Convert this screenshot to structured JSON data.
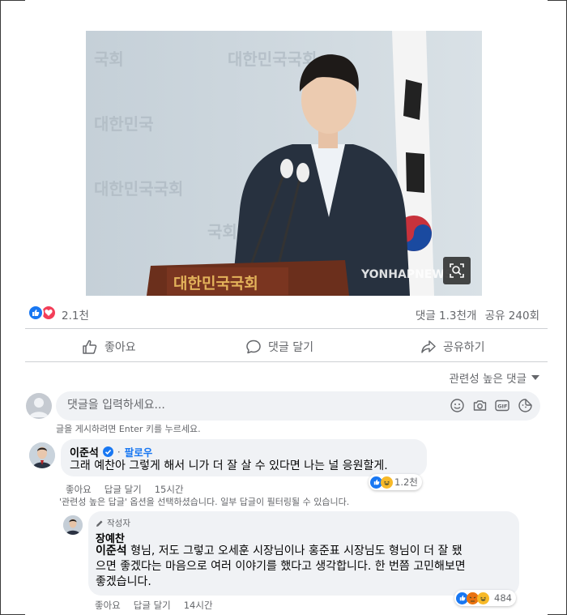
{
  "post": {
    "photo": {
      "wall_text": "대한민국국회",
      "podium_text": "대한민국국회",
      "watermark": "YONHAPNEWS"
    },
    "reactions": {
      "count": "2.1천"
    },
    "stats": {
      "comments": "댓글 1.3천개",
      "shares": "공유 240회"
    },
    "actions": {
      "like": "좋아요",
      "comment": "댓글 달기",
      "share": "공유하기"
    },
    "sort_label": "관련성 높은 댓글",
    "comment_input": {
      "placeholder": "댓글을 입력하세요...",
      "hint": "글을 게시하려면 Enter 키를 누르세요."
    },
    "filter_note": "'관련성 높은 답글' 옵션을 선택하셨습니다. 일부 답글이 필터링될 수 있습니다."
  },
  "comments": [
    {
      "author": "이준석",
      "verified": true,
      "follow": "팔로우",
      "text": "그래 예찬아 그렇게 해서 니가 더 잘 살 수 있다면 나는 널 응원할게.",
      "like": "좋아요",
      "reply": "답글 달기",
      "time": "15시간",
      "reaction_count": "1.2천"
    }
  ],
  "reply": {
    "author_badge": "작성자",
    "author": "장예찬",
    "mention": "이준석",
    "text_line1": " 형님, 저도 그렇고 오세훈 시장님이나 홍준표 시장님도 형님이 더 잘 됐",
    "text_line2": "으면 좋겠다는 마음으로 여러 이야기를 했다고 생각합니다. 한 번쯤 고민해보면",
    "text_line3": "좋겠습니다.",
    "like": "좋아요",
    "reply": "답글 달기",
    "time": "14시간",
    "reaction_count": "484"
  },
  "colors": {
    "like_blue": "#1877f2",
    "love_red": "#f33e58",
    "haha_yellow": "#f7b928",
    "text_gray": "#65676b",
    "bubble_bg": "#f0f2f5"
  }
}
